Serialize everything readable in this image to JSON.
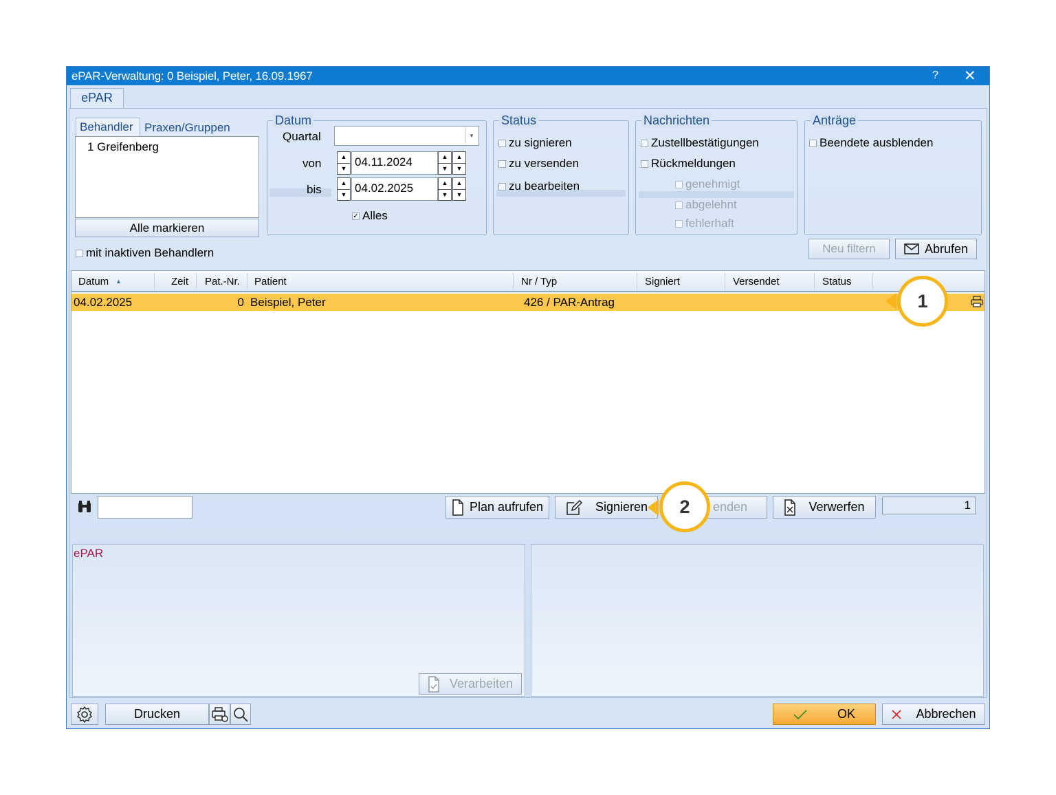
{
  "window": {
    "title": "ePAR-Verwaltung: 0 Beispiel, Peter, 16.09.1967",
    "help": "?",
    "close": "✕"
  },
  "tabs": {
    "active": "ePAR"
  },
  "behandler": {
    "tab1": "Behandler",
    "tab2": "Praxen/Gruppen",
    "items": [
      "1 Greifenberg"
    ],
    "mark_all": "Alle markieren",
    "inactive_label": "mit inaktiven Behandlern"
  },
  "datum": {
    "title": "Datum",
    "quartal_label": "Quartal",
    "quartal_value": "",
    "von_label": "von",
    "von_value": "04.11.2024",
    "bis_label": "bis",
    "bis_value": "04.02.2025",
    "alles_label": "Alles"
  },
  "status": {
    "title": "Status",
    "items": [
      "zu signieren",
      "zu versenden",
      "zu bearbeiten"
    ]
  },
  "nachrichten": {
    "title": "Nachrichten",
    "items": [
      "Zustellbestätigungen",
      "Rückmeldungen"
    ],
    "sub_items": [
      "genehmigt",
      "abgelehnt",
      "fehlerhaft"
    ]
  },
  "antraege": {
    "title": "Anträge",
    "items": [
      "Beendete ausblenden"
    ]
  },
  "filter_buttons": {
    "neu_filtern": "Neu filtern",
    "abrufen": "Abrufen"
  },
  "table": {
    "columns": [
      "Datum",
      "Zeit",
      "Pat.-Nr.",
      "Patient",
      "Nr / Typ",
      "Signiert",
      "Versendet",
      "Status"
    ],
    "rows": [
      {
        "datum": "04.02.2025",
        "zeit": "",
        "pat_nr": "0",
        "patient": "Beispiel, Peter",
        "nr_typ": "426 / PAR-Antrag",
        "signiert": "",
        "versendet": "",
        "status": ""
      }
    ]
  },
  "actions": {
    "search_value": "",
    "plan_aufrufen": "Plan aufrufen",
    "signieren": "Signieren",
    "versenden_partial": "enden",
    "verwerfen": "Verwerfen",
    "count": "1"
  },
  "lower_panel": {
    "title": "ePAR",
    "verarbeiten": "Verarbeiten"
  },
  "bottom": {
    "drucken": "Drucken",
    "ok": "OK",
    "abbrechen": "Abbrechen"
  },
  "callouts": [
    "1",
    "2"
  ],
  "colors": {
    "titlebar": "#0f7bd3",
    "selected_row": "#fcc74a",
    "callout": "#f6b619",
    "ok_button": "#f9b94a",
    "cancel_x": "#d32f2f"
  }
}
